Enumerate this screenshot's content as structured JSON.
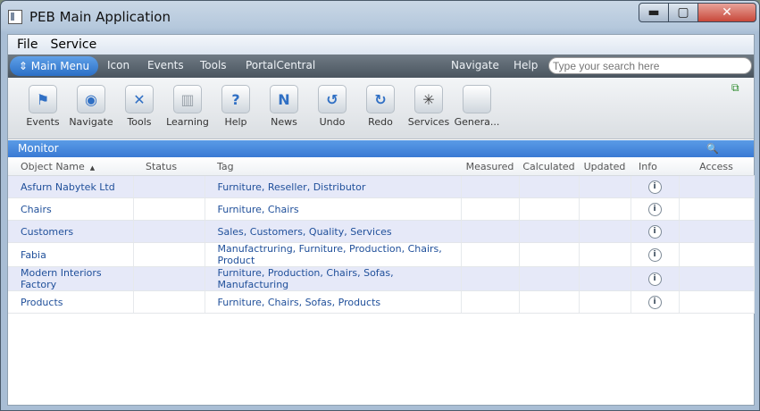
{
  "window": {
    "title": "PEB Main Application",
    "minimize_glyph": "▬",
    "maximize_glyph": "▢",
    "close_glyph": "✕"
  },
  "menubar": [
    "File",
    "Service"
  ],
  "navbar": {
    "main_menu_label": "⇕ Main Menu",
    "left_items": [
      "Icon",
      "Events",
      "Tools",
      "PortalCentral"
    ],
    "right_items": [
      "Navigate",
      "Help"
    ],
    "search_placeholder": "Type your search here"
  },
  "toolbar": [
    {
      "label": "Events",
      "icon": "events-icon",
      "glyph": "⚑",
      "color": "#2f6fc4"
    },
    {
      "label": "Navigate",
      "icon": "compass-icon",
      "glyph": "◉",
      "color": "#2f6fc4"
    },
    {
      "label": "Tools",
      "icon": "tools-icon",
      "glyph": "✕",
      "color": "#2f6fc4"
    },
    {
      "label": "Learning",
      "icon": "book-icon",
      "glyph": "▥",
      "color": "#9aa2aa"
    },
    {
      "label": "Help",
      "icon": "help-icon",
      "glyph": "?",
      "color": "#2f6fc4"
    },
    {
      "label": "News",
      "icon": "news-icon",
      "glyph": "N",
      "color": "#2f6fc4"
    },
    {
      "label": "Undo",
      "icon": "undo-icon",
      "glyph": "↺",
      "color": "#2f6fc4"
    },
    {
      "label": "Redo",
      "icon": "redo-icon",
      "glyph": "↻",
      "color": "#2f6fc4"
    },
    {
      "label": "Services",
      "icon": "services-icon",
      "glyph": "✳",
      "color": "#444"
    },
    {
      "label": "Genera...",
      "icon": "generic-icon",
      "glyph": "",
      "color": "#ccc"
    }
  ],
  "monitor": {
    "title": "Monitor",
    "zoom_glyph": "🔍"
  },
  "table": {
    "columns": [
      "Object Name",
      "Status",
      "Tag",
      "Measured",
      "Calculated",
      "Updated",
      "Info",
      "Access"
    ],
    "rows": [
      {
        "name": "Asfurn Nabytek Ltd",
        "status": "",
        "tag": "Furniture, Reseller, Distributor"
      },
      {
        "name": "Chairs",
        "status": "",
        "tag": "Furniture, Chairs"
      },
      {
        "name": "Customers",
        "status": "",
        "tag": "Sales, Customers, Quality, Services"
      },
      {
        "name": "Fabia",
        "status": "",
        "tag": "Manufactruring, Furniture, Production, Chairs, Product"
      },
      {
        "name": "Modern Interiors Factory",
        "status": "",
        "tag": "Furniture, Production, Chairs, Sofas, Manufacturing"
      },
      {
        "name": "Products",
        "status": "",
        "tag": "Furniture, Chairs, Sofas, Products"
      }
    ],
    "info_glyph": "i"
  }
}
